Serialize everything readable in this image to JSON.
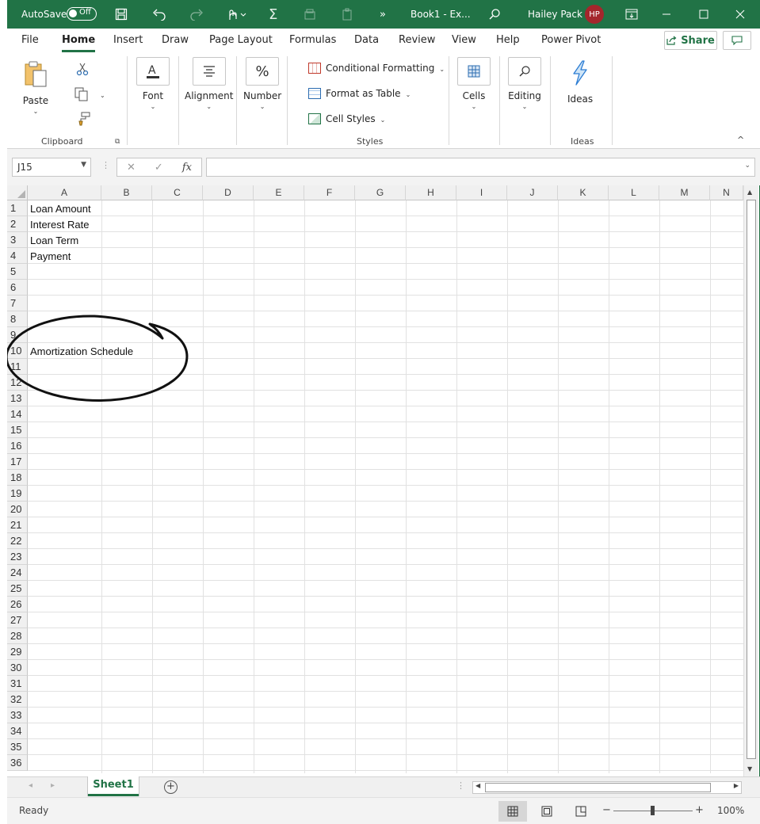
{
  "titlebar": {
    "autosave_label": "AutoSave",
    "autosave_state": "Off",
    "doc_title": "Book1 - Ex...",
    "user_name": "Hailey Pack",
    "user_initials": "HP",
    "more_glyph": "»"
  },
  "menu": {
    "items": [
      "File",
      "Home",
      "Insert",
      "Draw",
      "Page Layout",
      "Formulas",
      "Data",
      "Review",
      "View",
      "Help",
      "Power Pivot"
    ],
    "active": "Home",
    "share_label": "Share"
  },
  "ribbon": {
    "paste_label": "Paste",
    "clipboard_label": "Clipboard",
    "font_label": "Font",
    "alignment_label": "Alignment",
    "number_label": "Number",
    "number_icon": "%",
    "styles": {
      "conditional_formatting": "Conditional Formatting",
      "format_as_table": "Format as Table",
      "cell_styles": "Cell Styles",
      "group_label": "Styles"
    },
    "cells_label": "Cells",
    "editing_label": "Editing",
    "ideas_label": "Ideas",
    "ideas_group_label": "Ideas"
  },
  "formula_bar": {
    "name_box": "J15",
    "formula": "",
    "fx": "fx"
  },
  "grid": {
    "columns": [
      "A",
      "B",
      "C",
      "D",
      "E",
      "F",
      "G",
      "H",
      "I",
      "J",
      "K",
      "L",
      "M",
      "N"
    ],
    "rows": [
      "1",
      "2",
      "3",
      "4",
      "5",
      "6",
      "7",
      "8",
      "9",
      "10",
      "11",
      "12",
      "13",
      "14",
      "15",
      "16",
      "17",
      "18",
      "19",
      "20",
      "21",
      "22",
      "23",
      "24",
      "25",
      "26",
      "27",
      "28",
      "29",
      "30",
      "31",
      "32",
      "33",
      "34",
      "35",
      "36"
    ],
    "cells": {
      "A1": "Loan Amount",
      "A2": "Interest Rate",
      "A3": "Loan Term",
      "A4": "Payment",
      "A10": "Amortization Schedule"
    }
  },
  "sheets": {
    "tabs": [
      "Sheet1"
    ],
    "active": "Sheet1",
    "add_glyph": "+"
  },
  "status": {
    "ready": "Ready",
    "zoom": "100%",
    "zoom_minus": "−",
    "zoom_plus": "+"
  },
  "colors": {
    "excel_green": "#217346",
    "avatar": "#a4262c"
  }
}
